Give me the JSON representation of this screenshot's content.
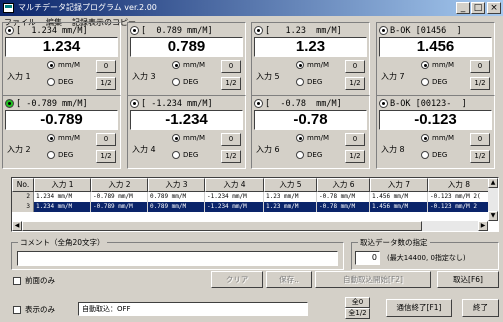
{
  "window": {
    "title": "マルチデータ記録プログラム ver.2.00",
    "btn_min": "_",
    "btn_max": "□",
    "btn_close": "×"
  },
  "menu": [
    "ファイル",
    "編集",
    "記録表示のコピー"
  ],
  "channels": [
    {
      "header": "[  1.234 mm/M]",
      "value": "1.234",
      "input_label": "入力 1",
      "radio_green": false
    },
    {
      "header": "[  0.789 mm/M]",
      "value": "0.789",
      "input_label": "入力 3",
      "radio_green": false
    },
    {
      "header": "[   1.23  mm/M]",
      "value": "1.23",
      "input_label": "入力 5",
      "radio_green": false
    },
    {
      "header": "B-OK [01456  ]",
      "value": "1.456",
      "input_label": "入力 7",
      "radio_green": false
    },
    {
      "header": "[ -0.789 mm/M]",
      "value": "-0.789",
      "input_label": "入力 2",
      "radio_green": true
    },
    {
      "header": "[ -1.234 mm/M]",
      "value": "-1.234",
      "input_label": "入力 4",
      "radio_green": false
    },
    {
      "header": "[  -0.78  mm/M]",
      "value": "-0.78",
      "input_label": "入力 6",
      "radio_green": false
    },
    {
      "header": "B-OK [00123-  ]",
      "value": "-0.123",
      "input_label": "入力 8",
      "radio_green": false
    }
  ],
  "channel_options": {
    "mm": "mm/M",
    "deg": "DEG",
    "zero": "0",
    "half": "1/2"
  },
  "table": {
    "headers": [
      "No.",
      "入力 1",
      "入力 2",
      "入力 3",
      "入力 4",
      "入力 5",
      "入力 6",
      "入力 7",
      "入力 8"
    ],
    "rows": [
      [
        "2",
        "1.234 mm/M",
        "-0.789 mm/M",
        "0.789 mm/M",
        "-1.234 mm/M",
        "1.23 mm/M",
        "-0.78 mm/M",
        "1.456 mm/M",
        "-0.123 mm/M 2("
      ],
      [
        "3",
        "1.234 mm/M",
        "-0.789 mm/M",
        "0.789 mm/M",
        "-1.234 mm/M",
        "1.23 mm/M",
        "-0.78 mm/M",
        "1.456 mm/M",
        "-0.123 mm/M 2"
      ]
    ],
    "selected_row": 1
  },
  "comment": {
    "label": "コメント（全角20文字）",
    "value": ""
  },
  "capture": {
    "label": "取込データ数の指定",
    "value": "0",
    "hint": "(最大14400, 0指定なし)"
  },
  "buttons": {
    "clear": "クリア",
    "save": "保存..",
    "auto_start": "自動取込開始[F2]",
    "capture": "取込[F6]",
    "all_zero": "全0",
    "all_half": "全1/2",
    "comm_end": "通信終了[F1]",
    "exit": "終了"
  },
  "checks": {
    "front_only": "前面のみ",
    "display_only": "表示のみ"
  },
  "status": "自動取込：OFF"
}
